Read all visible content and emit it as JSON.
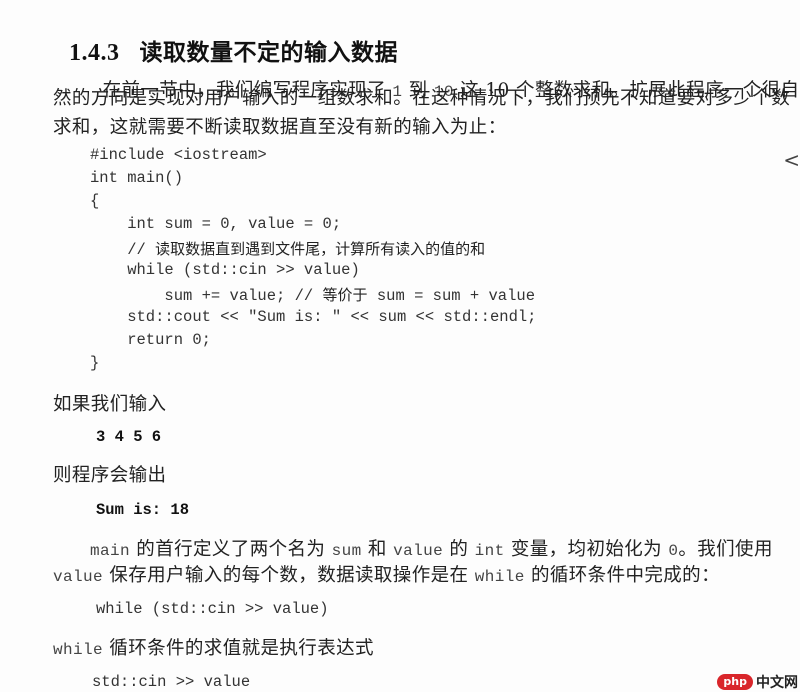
{
  "heading": {
    "number": "1.4.3",
    "title": "读取数量不定的输入数据"
  },
  "intro": {
    "line1_a": "在前一节中，我们编写程序实现了",
    "line1_n1": "1",
    "line1_b": "到",
    "line1_n2": "10",
    "line1_c": "这 10 个整数求和。扩展此程序一个很自",
    "line2": "然的方向是实现对用户输入的一组数求和。在这种情况下，我们预先不知道要对多少个数",
    "line3": "求和，这就需要不断读取数据直至没有新的输入为止："
  },
  "code_block": {
    "lines": [
      "#include <iostream>",
      "int main()",
      "{",
      "    int sum = 0, value = 0;",
      "    // ",
      "    while (std::cin >> value)",
      "        sum += value; // ",
      "    std::cout << \"Sum is: \" << sum << std::endl;",
      "    return 0;",
      "}"
    ],
    "comment_line4": "读取数据直到遇到文件尾，计算所有读入的值的和",
    "comment_line6_cjk": "等价于",
    "comment_line6_tail": "sum = sum + value"
  },
  "input_label": "如果我们输入",
  "input_example": "3 4 5 6",
  "output_label": "则程序会输出",
  "output_example": "Sum is: 18",
  "explain": {
    "l1_main": "main",
    "l1_a": "的首行定义了两个名为",
    "l1_sum": "sum",
    "l1_b": "和",
    "l1_value": "value",
    "l1_c": "的",
    "l1_int": "int",
    "l1_d": "变量，均初始化为",
    "l1_zero": "0",
    "l1_e": "。我们使用",
    "l2_value": "value",
    "l2_a": "保存用户输入的每个数，数据读取操作是在",
    "l2_while": "while",
    "l2_b": "的循环条件中完成的："
  },
  "loop_code": "while (std::cin >> value)",
  "loop_desc": {
    "keyword": "while",
    "text": "循环条件的求值就是执行表达式"
  },
  "expr_code": "std::cin >> value",
  "side_chevron": "<",
  "watermark": {
    "logo": "php",
    "text": "中文网"
  }
}
